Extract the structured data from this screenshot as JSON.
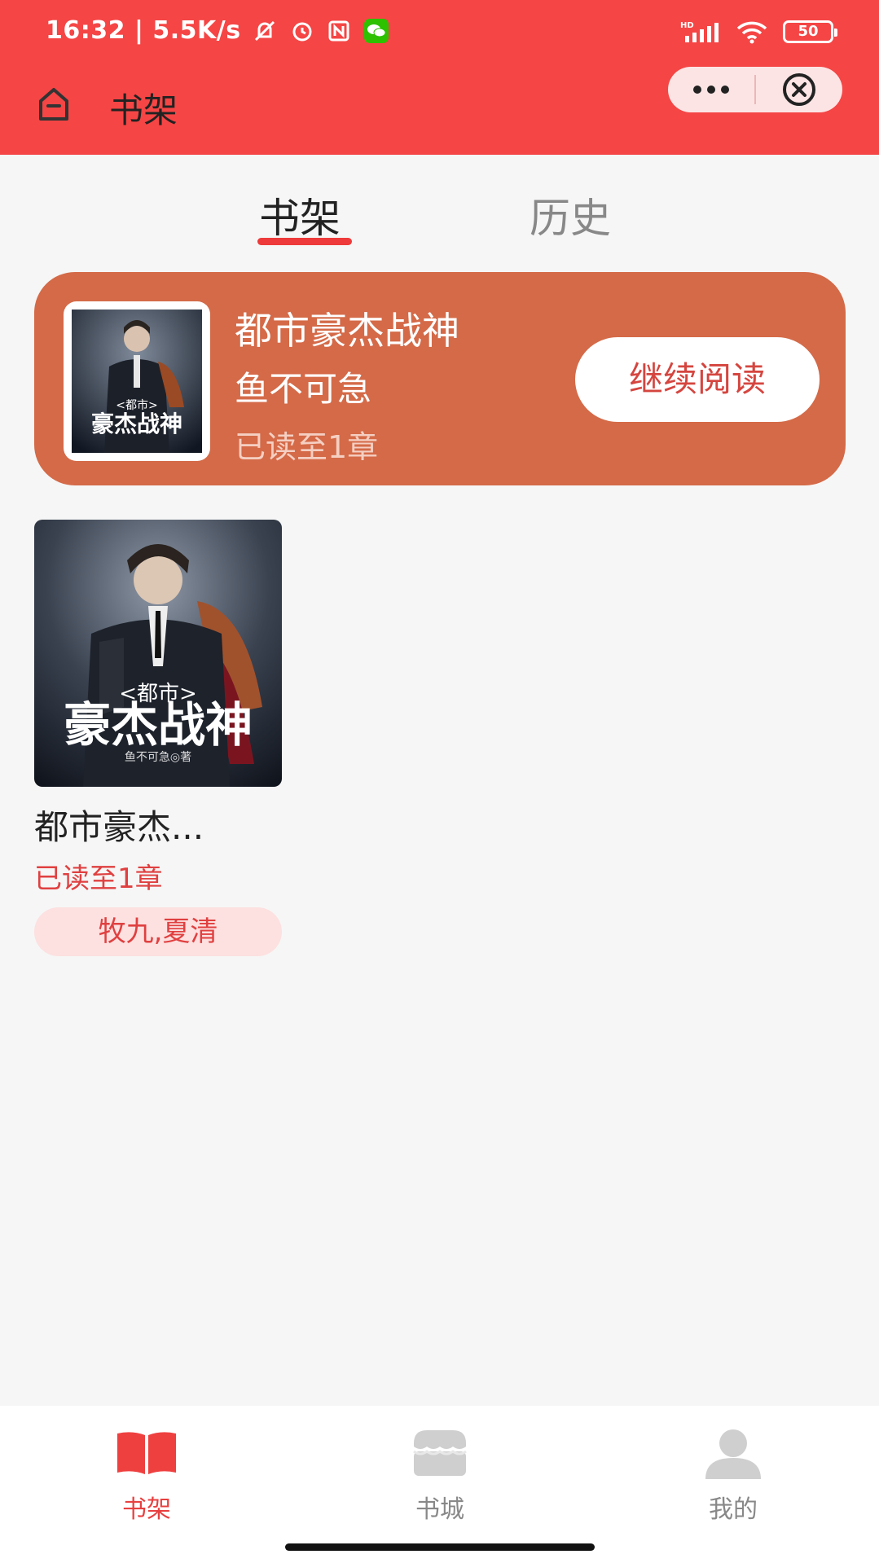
{
  "status": {
    "time_speed": "16:32 | 5.5K/s",
    "battery": "50",
    "network": "HD"
  },
  "header": {
    "title": "书架",
    "home_icon": "home-icon",
    "more_icon": "more-dots-icon",
    "close_icon": "close-circle-icon",
    "background_color": "#f54545"
  },
  "tabs": [
    {
      "label": "书架",
      "active": true
    },
    {
      "label": "历史",
      "active": false
    }
  ],
  "continue_card": {
    "title": "都市豪杰战神",
    "author": "鱼不可急",
    "progress": "已读至1章",
    "button_label": "继续阅读",
    "background_color": "#d46a48"
  },
  "books": [
    {
      "cover_text_small": "<都市>",
      "cover_text_big": "豪杰战神",
      "cover_byline": "鱼不可急◎著",
      "title": "都市豪杰...",
      "progress": "已读至1章",
      "tag": "牧九,夏清"
    }
  ],
  "tabbar": [
    {
      "label": "书架",
      "icon": "open-book-icon",
      "active": true
    },
    {
      "label": "书城",
      "icon": "store-icon",
      "active": false
    },
    {
      "label": "我的",
      "icon": "user-icon",
      "active": false
    }
  ],
  "colors": {
    "accent": "#ee3a3a",
    "tag_bg": "#fde0e0"
  }
}
